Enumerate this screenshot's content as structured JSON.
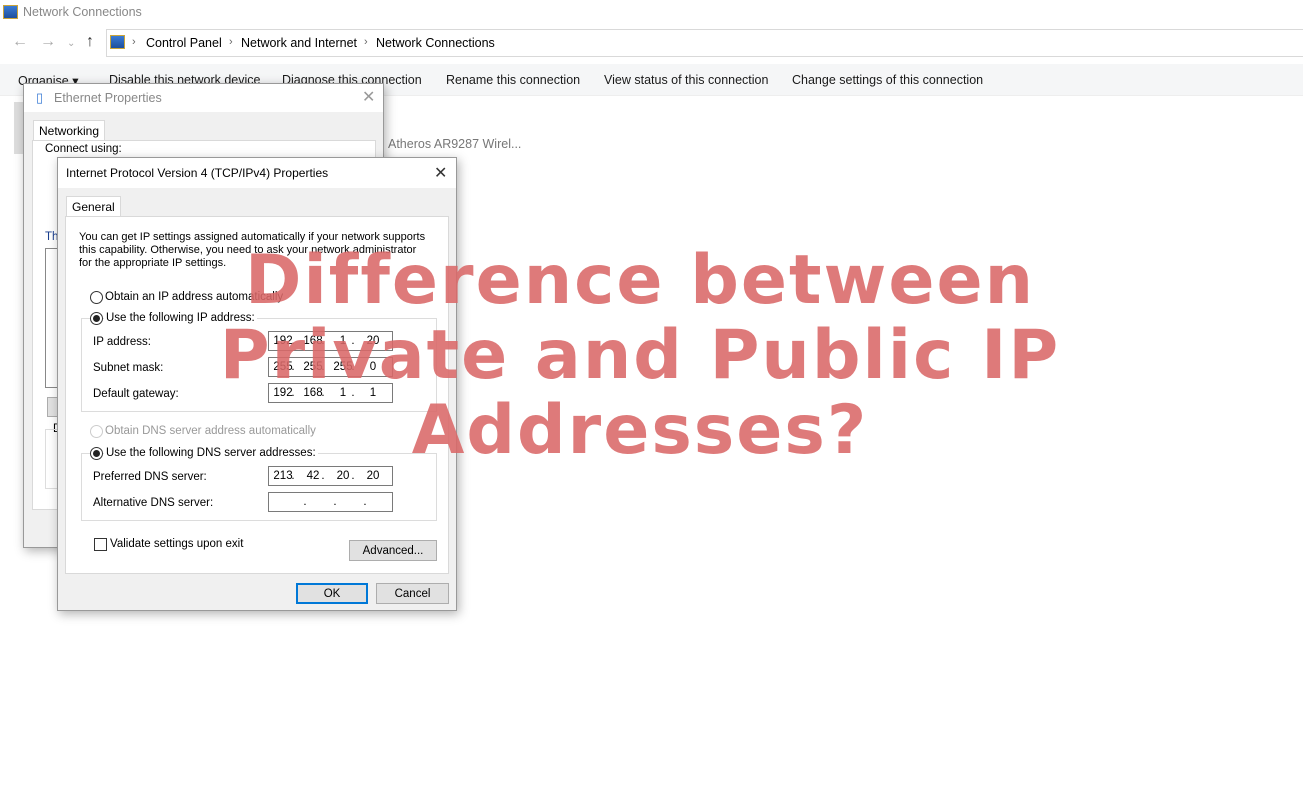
{
  "window": {
    "title": "Network Connections"
  },
  "breadcrumb": [
    "Control Panel",
    "Network and Internet",
    "Network Connections"
  ],
  "commands": [
    "Organise ▾",
    "Disable this network device",
    "Diagnose this connection",
    "Rename this connection",
    "View status of this connection",
    "Change settings of this connection"
  ],
  "background_item": "Atheros AR9287 Wirel...",
  "ethernet_dialog": {
    "title": "Ethernet Properties",
    "tab": "Networking",
    "connect_using": "Connect using:",
    "this_label": "Th",
    "d_label": "D"
  },
  "ipv4_dialog": {
    "title": "Internet Protocol Version 4 (TCP/IPv4) Properties",
    "tab": "General",
    "description": [
      "You can get IP settings assigned automatically if your network supports",
      "this capability. Otherwise, you need to ask your network administrator",
      "for the appropriate IP settings."
    ],
    "obtain_ip_auto": "Obtain an IP address automatically",
    "use_following_ip": "Use the following IP address:",
    "ip_selected": "manual",
    "fields": [
      {
        "label": "IP address:",
        "value": [
          "192",
          "168",
          "1",
          "20"
        ]
      },
      {
        "label": "Subnet mask:",
        "value": [
          "255",
          "255",
          "255",
          "0"
        ]
      },
      {
        "label": "Default gateway:",
        "value": [
          "192",
          "168",
          "1",
          "1"
        ]
      }
    ],
    "obtain_dns_auto": "Obtain DNS server address automatically",
    "use_following_dns": "Use the following DNS server addresses:",
    "dns_fields": [
      {
        "label": "Preferred DNS server:",
        "value": [
          "213",
          "42",
          "20",
          "20"
        ]
      },
      {
        "label": "Alternative DNS server:",
        "value": [
          "",
          "",
          "",
          ""
        ]
      }
    ],
    "validate": "Validate settings upon exit",
    "validate_checked": false,
    "advanced": "Advanced...",
    "ok": "OK",
    "cancel": "Cancel"
  },
  "overlay": {
    "lines": [
      "Difference between",
      "Private and Public IP",
      "Addresses?"
    ],
    "color": "#da6868"
  }
}
